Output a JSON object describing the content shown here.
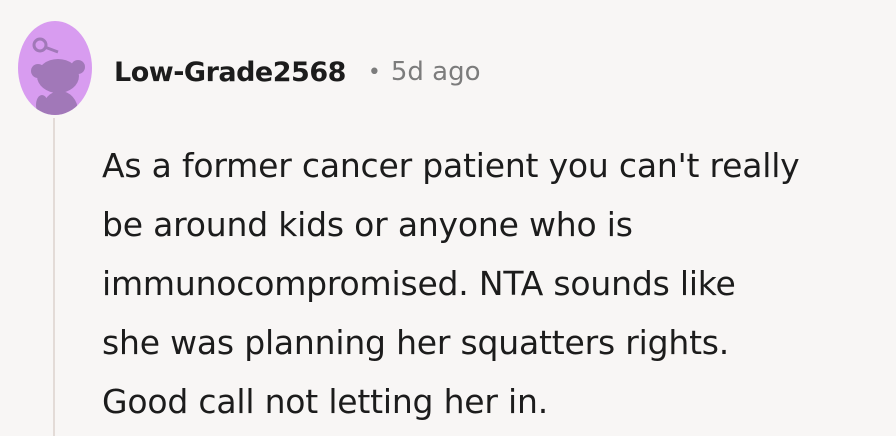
{
  "comment": {
    "username": "Low-Grade2568",
    "separator": "•",
    "timestamp": "5d ago",
    "body_lines": [
      "As a former cancer patient you can't really",
      "be around kids or anyone who is",
      "immunocompromised. NTA sounds like",
      "she was planning her squatters rights.",
      "Good call not letting her in."
    ],
    "avatar_icon": "snoo-avatar-icon"
  },
  "colors": {
    "background": "#f8f6f5",
    "avatar_bg": "#d89cf0",
    "avatar_figure": "#a178b8",
    "username": "#1c1c1c",
    "meta": "#7c7c7c",
    "thread_line": "#e3dbd7"
  }
}
